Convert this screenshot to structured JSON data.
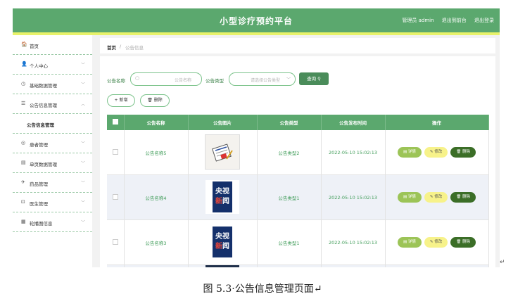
{
  "header": {
    "title": "小型诊疗预约平台",
    "admin": "管理员 admin",
    "front": "退出到前台",
    "logout": "退出登录"
  },
  "sidebar": {
    "items": [
      {
        "icon": "🏠",
        "label": "首页",
        "arrow": ""
      },
      {
        "icon": "👤",
        "label": "个人中心",
        "arrow": "﹀"
      },
      {
        "icon": "◷",
        "label": "基础数据管理",
        "arrow": "﹀"
      },
      {
        "icon": "☰",
        "label": "公告信息管理",
        "arrow": "︿"
      },
      {
        "icon": "",
        "label": "公告信息管理",
        "arrow": ""
      },
      {
        "icon": "◎",
        "label": "患者管理",
        "arrow": "﹀"
      },
      {
        "icon": "▤",
        "label": "单页数据管理",
        "arrow": "﹀"
      },
      {
        "icon": "✈",
        "label": "药品管理",
        "arrow": "﹀"
      },
      {
        "icon": "⊡",
        "label": "医生管理",
        "arrow": "﹀"
      },
      {
        "icon": "▦",
        "label": "轮播图信息",
        "arrow": "﹀"
      }
    ]
  },
  "breadcrumb": {
    "home": "首页",
    "sep": "/",
    "current": "公告信息"
  },
  "search": {
    "name_label": "公告名称",
    "name_placeholder": "公告名称",
    "type_label": "公告类型",
    "type_placeholder": "请选择公告类型",
    "query_btn": "查询 ⚲"
  },
  "actions": {
    "add": "+ 新增",
    "delete": "🗑 删除"
  },
  "table": {
    "headers": [
      "公告名称",
      "公告图片",
      "公告类型",
      "公告发布时间",
      "操作"
    ],
    "rows": [
      {
        "name": "公告名称5",
        "image": "news",
        "type": "公告类型2",
        "time": "2022-05-10 15:02:13"
      },
      {
        "name": "公告名称4",
        "image": "cctv",
        "type": "公告类型1",
        "time": "2022-05-10 15:02:13"
      },
      {
        "name": "公告名称3",
        "image": "cctv",
        "type": "公告类型1",
        "time": "2022-05-10 15:02:13"
      }
    ],
    "ops": {
      "detail": "▤ 详情",
      "edit": "✎ 修改",
      "del": "🗑 删除"
    }
  },
  "caption": "图 5.3·公告信息管理页面↵",
  "return_mark": "↵",
  "colors": {
    "primary": "#5ba86e",
    "accent_yellow": "#e8f26a",
    "dark_green": "#3b6e27"
  }
}
